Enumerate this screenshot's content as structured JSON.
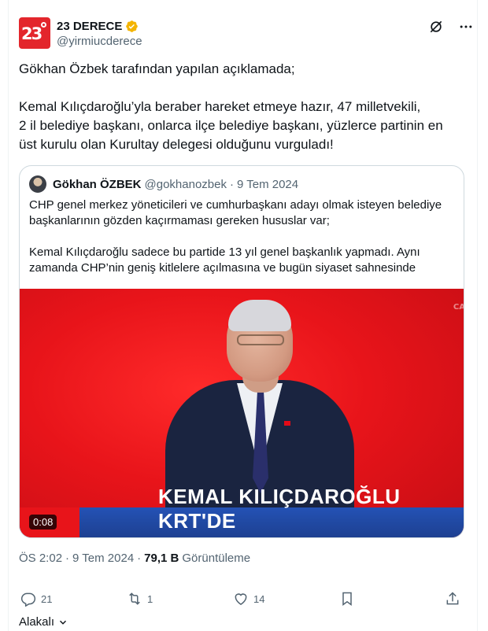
{
  "author": {
    "display_name": "23 DERECE",
    "handle": "@yirmiucderece",
    "avatar_label": "23",
    "verified": true
  },
  "tweet": {
    "line1": "Gökhan Özbek tarafından yapılan açıklamada;",
    "paragraph2_lines": [
      "Kemal Kılıçdaroğlu’yla beraber hareket etmeye hazır, 47 milletvekili,",
      "2 il belediye başkanı, onlarca ilçe belediye başkanı, yüzlerce partinin en",
      "üst kurulu olan Kurultay delegesi olduğunu vurguladı!"
    ]
  },
  "quote": {
    "name": "Gökhan ÖZBEK",
    "handle": "@gokhanozbek",
    "separator": "·",
    "date": "9 Tem 2024",
    "paragraph1_lines": [
      "CHP genel merkez yöneticileri ve cumhurbaşkanı adayı olmak isteyen belediye",
      "başkanlarının gözden kaçırmaması gereken hususlar var;"
    ],
    "paragraph2_lines": [
      "Kemal Kılıçdaroğlu sadece bu partide 13 yıl genel başkanlık yapmadı. Aynı",
      "zamanda CHP’nin geniş kitlelere açılmasına ve bugün siyaset sahnesinde"
    ],
    "video": {
      "caption": "KEMAL KILIÇDAROĞLU KRT'DE",
      "duration": "0:08"
    }
  },
  "meta": {
    "time": "ÖS 2:02",
    "separator": "·",
    "date": "9 Tem 2024",
    "views_count": "79,1 B",
    "views_label": "Görüntüleme"
  },
  "actions": {
    "reply_count": "21",
    "retweet_count": "1",
    "like_count": "14"
  },
  "footer": {
    "more_label": "Alakalı"
  },
  "colors": {
    "text": "#0f1419",
    "secondary": "#536471",
    "border": "#cfd9de",
    "brand_red": "#e3262c",
    "verified_gold": "#f4b400"
  },
  "icons": [
    "verified-badge-icon",
    "grok-icon",
    "more-icon",
    "reply-icon",
    "retweet-icon",
    "like-icon",
    "bookmark-icon",
    "share-icon",
    "chevron-down-icon"
  ]
}
